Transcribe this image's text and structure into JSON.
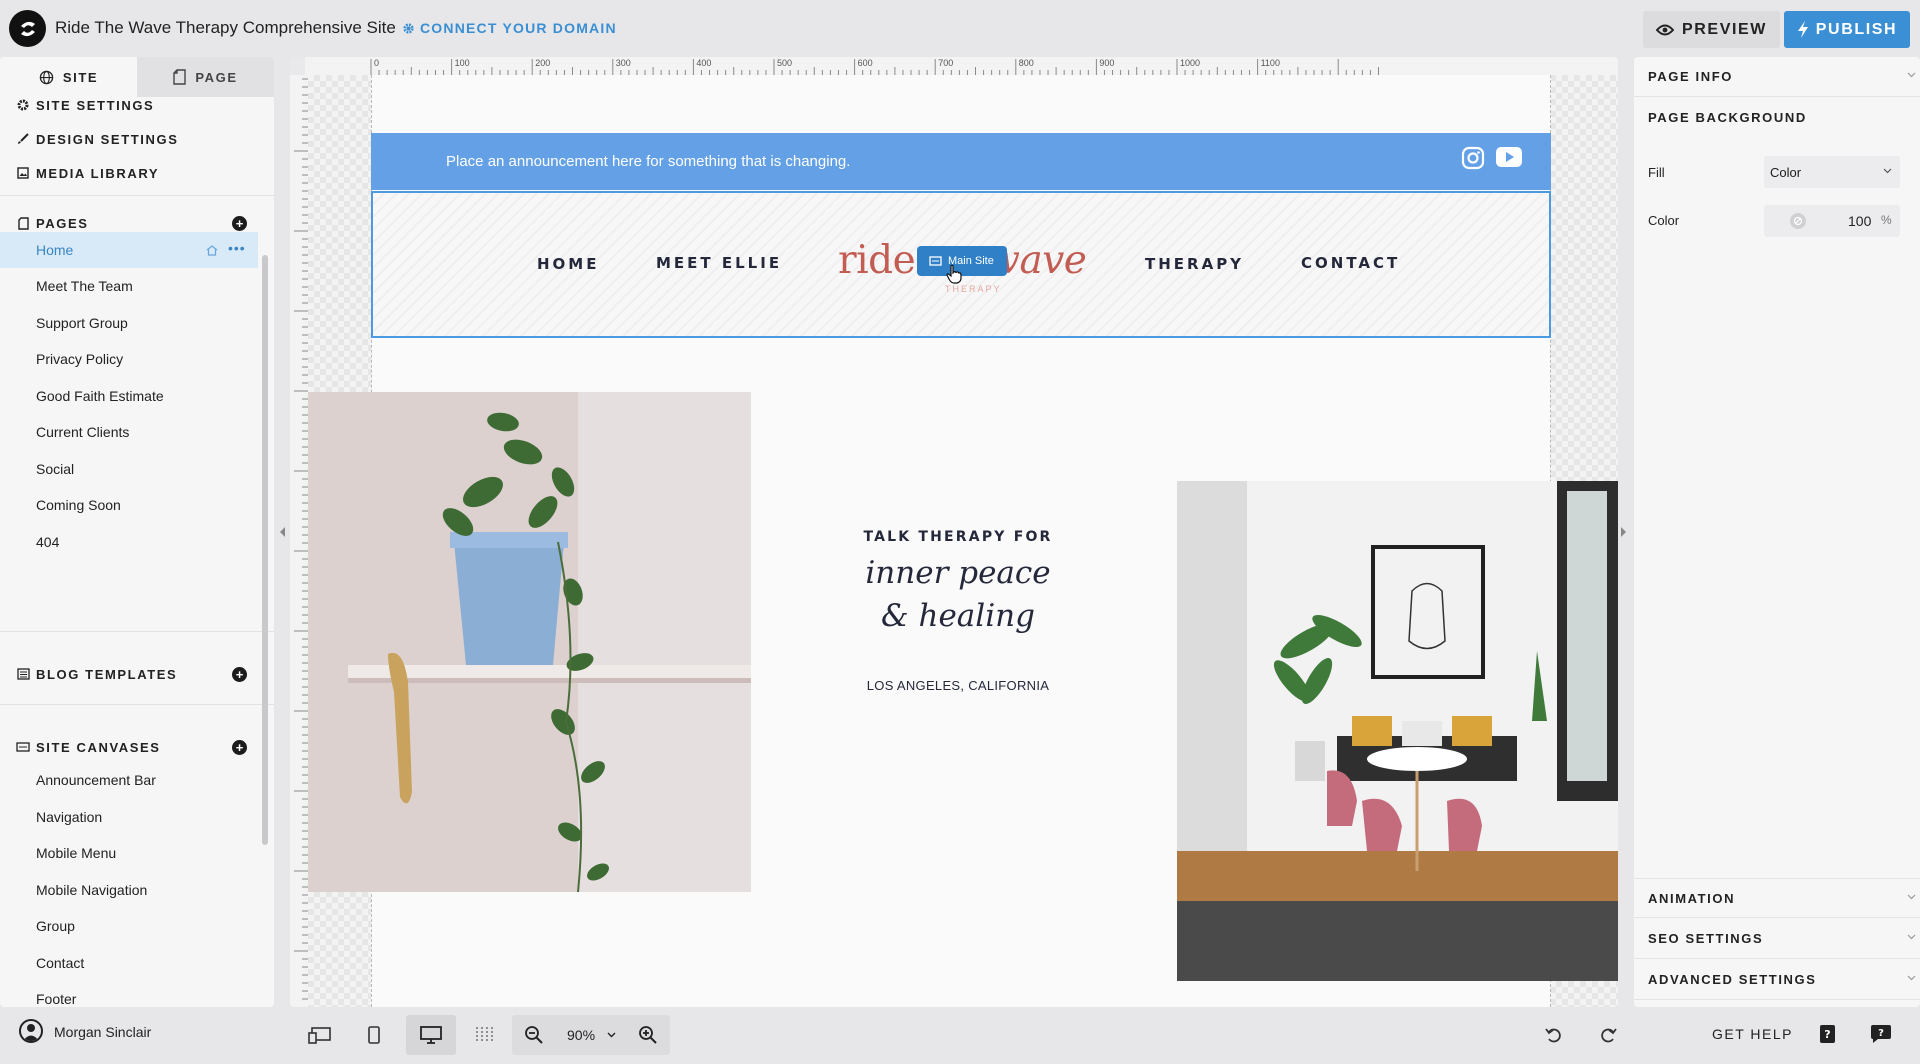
{
  "topbar": {
    "site_title": "Ride The Wave Therapy Comprehensive Site",
    "connect_domain": "CONNECT YOUR DOMAIN",
    "preview_label": "PREVIEW",
    "publish_label": "PUBLISH"
  },
  "left_panel": {
    "tabs": [
      {
        "label": "SITE",
        "icon": "globe-icon"
      },
      {
        "label": "PAGE",
        "icon": "page-icon"
      }
    ],
    "settings": [
      {
        "label": "SITE SETTINGS",
        "icon": "gear-icon"
      },
      {
        "label": "DESIGN SETTINGS",
        "icon": "brush-icon"
      },
      {
        "label": "MEDIA LIBRARY",
        "icon": "image-icon"
      }
    ],
    "pages_title": "PAGES",
    "pages": [
      "Home",
      "Meet The Team",
      "Support Group",
      "Privacy Policy",
      "Good Faith Estimate",
      "Current Clients",
      "Social",
      "Coming Soon",
      "404"
    ],
    "active_page": "Home",
    "blog_templates_title": "BLOG TEMPLATES",
    "site_canvases_title": "SITE CANVASES",
    "canvases": [
      "Announcement Bar",
      "Navigation",
      "Mobile Menu",
      "Mobile Navigation",
      "Group",
      "Contact",
      "Footer"
    ]
  },
  "ruler": {
    "ticks": [
      "0",
      "100",
      "200",
      "300",
      "400",
      "500",
      "600",
      "700",
      "800",
      "900",
      "1000",
      "1100"
    ]
  },
  "site": {
    "announcement": "Place an announcement here for something that is changing.",
    "nav": {
      "links": [
        "HOME",
        "MEET ELLIE",
        "THERAPY",
        "CONTACT"
      ],
      "logo_left": "ride",
      "logo_right": "wave",
      "logo_sub": "THERAPY",
      "badge": "Main Site"
    },
    "hero": {
      "kicker": "TALK THERAPY FOR",
      "line1": "inner peace",
      "line2": "& healing",
      "location": "LOS ANGELES, CALIFORNIA"
    },
    "colors": {
      "announcement_bg": "#63a0e6",
      "logo": "#c35c52",
      "accent": "#3b8fd5"
    }
  },
  "right_panel": {
    "page_info": "PAGE INFO",
    "page_background": "PAGE BACKGROUND",
    "fill_label": "Fill",
    "fill_value": "Color",
    "color_label": "Color",
    "opacity_value": "100",
    "opacity_unit": "%",
    "animation": "ANIMATION",
    "seo_settings": "SEO SETTINGS",
    "advanced_settings": "ADVANCED SETTINGS"
  },
  "bottombar": {
    "user_name": "Morgan Sinclair",
    "zoom": "90%",
    "get_help": "GET HELP"
  }
}
